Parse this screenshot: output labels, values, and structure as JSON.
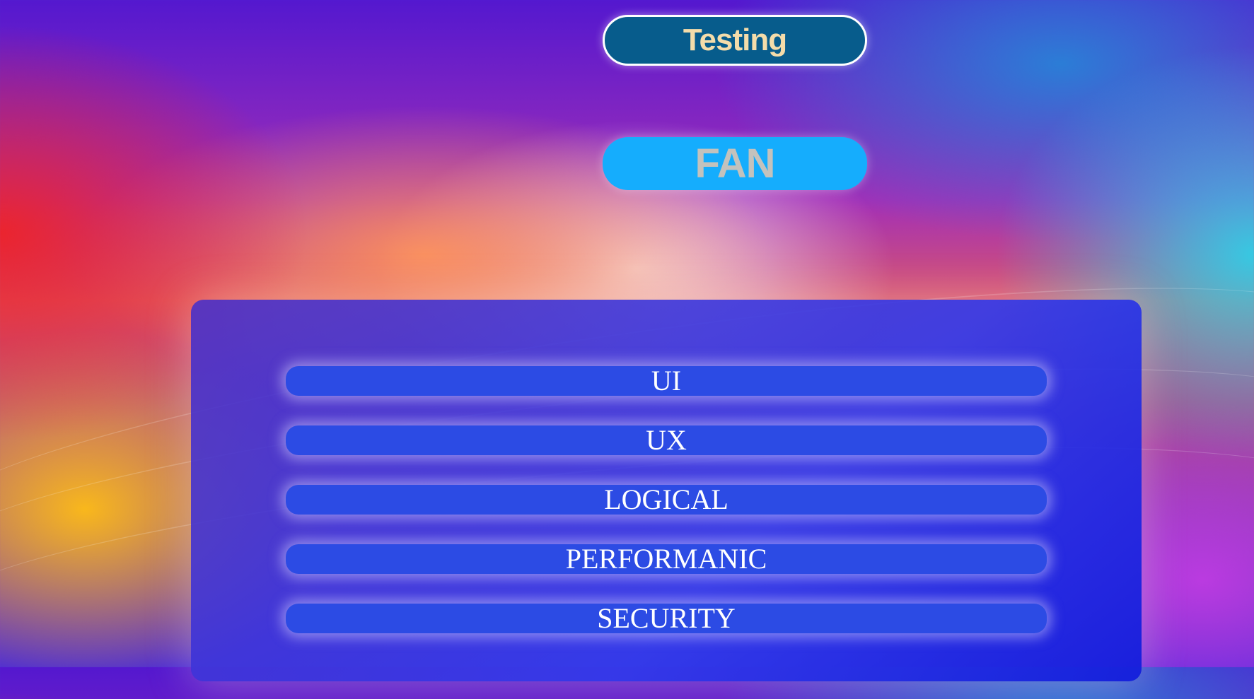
{
  "header": {
    "title": "Testing",
    "subtitle": "FAN"
  },
  "colors": {
    "title_bg": "#075c8c",
    "title_text": "#f4dcaa",
    "subtitle_bg": "#15adfd",
    "subtitle_text": "#c3c2bd",
    "panel_bg": "#3f45e0",
    "item_bg": "#2c4be4",
    "item_text": "#ffffff"
  },
  "menu": {
    "items": [
      {
        "label": "UI"
      },
      {
        "label": "UX"
      },
      {
        "label": "LOGICAL"
      },
      {
        "label": "PERFORMANIC"
      },
      {
        "label": "SECURITY"
      }
    ]
  }
}
